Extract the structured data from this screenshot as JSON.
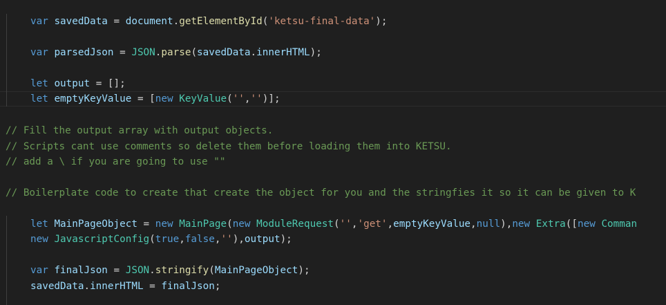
{
  "editor": {
    "lines": [
      {
        "id": "saved-data-decl",
        "indent": true,
        "tokens": [
          {
            "t": "var",
            "c": "kw"
          },
          {
            "t": " ",
            "c": "pun"
          },
          {
            "t": "savedData",
            "c": "var"
          },
          {
            "t": " = ",
            "c": "pun"
          },
          {
            "t": "document",
            "c": "var"
          },
          {
            "t": ".",
            "c": "pun"
          },
          {
            "t": "getElementById",
            "c": "fn"
          },
          {
            "t": "(",
            "c": "pun"
          },
          {
            "t": "'ketsu-final-data'",
            "c": "str"
          },
          {
            "t": ");",
            "c": "pun"
          }
        ]
      },
      {
        "id": "parsed-json-decl",
        "indent": true,
        "tokens": [
          {
            "t": "var",
            "c": "kw"
          },
          {
            "t": " ",
            "c": "pun"
          },
          {
            "t": "parsedJson",
            "c": "var"
          },
          {
            "t": " = ",
            "c": "pun"
          },
          {
            "t": "JSON",
            "c": "cls"
          },
          {
            "t": ".",
            "c": "pun"
          },
          {
            "t": "parse",
            "c": "fn"
          },
          {
            "t": "(",
            "c": "pun"
          },
          {
            "t": "savedData",
            "c": "var"
          },
          {
            "t": ".",
            "c": "pun"
          },
          {
            "t": "innerHTML",
            "c": "var"
          },
          {
            "t": ");",
            "c": "pun"
          }
        ]
      },
      {
        "id": "output-decl",
        "indent": true,
        "tokens": [
          {
            "t": "let",
            "c": "kw"
          },
          {
            "t": " ",
            "c": "pun"
          },
          {
            "t": "output",
            "c": "var"
          },
          {
            "t": " = [];",
            "c": "pun"
          }
        ]
      },
      {
        "id": "empty-key-value-decl",
        "indent": true,
        "tokens": [
          {
            "t": "let",
            "c": "kw"
          },
          {
            "t": " ",
            "c": "pun"
          },
          {
            "t": "emptyKeyValue",
            "c": "var"
          },
          {
            "t": " = [",
            "c": "pun"
          },
          {
            "t": "new",
            "c": "kw"
          },
          {
            "t": " ",
            "c": "pun"
          },
          {
            "t": "KeyValue",
            "c": "cls"
          },
          {
            "t": "(",
            "c": "pun"
          },
          {
            "t": "''",
            "c": "str"
          },
          {
            "t": ",",
            "c": "pun"
          },
          {
            "t": "''",
            "c": "str"
          },
          {
            "t": ")];",
            "c": "pun"
          }
        ]
      },
      {
        "id": "comment-fill-output",
        "indent": false,
        "tokens": [
          {
            "t": "// Fill the output array with output objects.",
            "c": "cmt"
          }
        ]
      },
      {
        "id": "comment-scripts",
        "indent": false,
        "tokens": [
          {
            "t": "// Scripts cant use comments so delete them before loading them into KETSU.",
            "c": "cmt"
          }
        ]
      },
      {
        "id": "comment-add-backslash",
        "indent": false,
        "tokens": [
          {
            "t": "// add a \\ if you are going to use \"\"",
            "c": "cmt"
          }
        ]
      },
      {
        "id": "comment-boilerplate",
        "indent": false,
        "tokens": [
          {
            "t": "// Boilerplate code to create that create the object for you and the stringfies it so it can be given to K",
            "c": "cmt"
          }
        ]
      },
      {
        "id": "main-page-object-decl",
        "indent": true,
        "tokens": [
          {
            "t": "let",
            "c": "kw"
          },
          {
            "t": " ",
            "c": "pun"
          },
          {
            "t": "MainPageObject",
            "c": "var"
          },
          {
            "t": " = ",
            "c": "pun"
          },
          {
            "t": "new",
            "c": "kw"
          },
          {
            "t": " ",
            "c": "pun"
          },
          {
            "t": "MainPage",
            "c": "cls"
          },
          {
            "t": "(",
            "c": "pun"
          },
          {
            "t": "new",
            "c": "kw"
          },
          {
            "t": " ",
            "c": "pun"
          },
          {
            "t": "ModuleRequest",
            "c": "cls"
          },
          {
            "t": "(",
            "c": "pun"
          },
          {
            "t": "''",
            "c": "str"
          },
          {
            "t": ",",
            "c": "pun"
          },
          {
            "t": "'get'",
            "c": "str"
          },
          {
            "t": ",",
            "c": "pun"
          },
          {
            "t": "emptyKeyValue",
            "c": "var"
          },
          {
            "t": ",",
            "c": "pun"
          },
          {
            "t": "null",
            "c": "kw"
          },
          {
            "t": "),",
            "c": "pun"
          },
          {
            "t": "new",
            "c": "kw"
          },
          {
            "t": " ",
            "c": "pun"
          },
          {
            "t": "Extra",
            "c": "cls"
          },
          {
            "t": "([",
            "c": "pun"
          },
          {
            "t": "new",
            "c": "kw"
          },
          {
            "t": " ",
            "c": "pun"
          },
          {
            "t": "Comman",
            "c": "cls"
          }
        ]
      },
      {
        "id": "javascript-config-line",
        "indent": true,
        "tokens": [
          {
            "t": "new",
            "c": "kw"
          },
          {
            "t": " ",
            "c": "pun"
          },
          {
            "t": "JavascriptConfig",
            "c": "cls"
          },
          {
            "t": "(",
            "c": "pun"
          },
          {
            "t": "true",
            "c": "kw"
          },
          {
            "t": ",",
            "c": "pun"
          },
          {
            "t": "false",
            "c": "kw"
          },
          {
            "t": ",",
            "c": "pun"
          },
          {
            "t": "''",
            "c": "str"
          },
          {
            "t": "),",
            "c": "pun"
          },
          {
            "t": "output",
            "c": "var"
          },
          {
            "t": ");",
            "c": "pun"
          }
        ]
      },
      {
        "id": "final-json-decl",
        "indent": true,
        "tokens": [
          {
            "t": "var",
            "c": "kw"
          },
          {
            "t": " ",
            "c": "pun"
          },
          {
            "t": "finalJson",
            "c": "var"
          },
          {
            "t": " = ",
            "c": "pun"
          },
          {
            "t": "JSON",
            "c": "cls"
          },
          {
            "t": ".",
            "c": "pun"
          },
          {
            "t": "stringify",
            "c": "fn"
          },
          {
            "t": "(",
            "c": "pun"
          },
          {
            "t": "MainPageObject",
            "c": "var"
          },
          {
            "t": ");",
            "c": "pun"
          }
        ]
      },
      {
        "id": "saved-data-assign",
        "indent": true,
        "tokens": [
          {
            "t": "savedData",
            "c": "var"
          },
          {
            "t": ".",
            "c": "pun"
          },
          {
            "t": "innerHTML",
            "c": "var"
          },
          {
            "t": " = ",
            "c": "pun"
          },
          {
            "t": "finalJson",
            "c": "var"
          },
          {
            "t": ";",
            "c": "pun"
          }
        ]
      }
    ]
  },
  "colors": {
    "background": "#1f1f1f",
    "keyword": "#569cd6",
    "variable": "#9cdcfe",
    "function": "#dcdcaa",
    "class": "#4ec9b0",
    "string": "#ce9178",
    "comment": "#6a9955",
    "punctuation": "#d4d4d4"
  }
}
